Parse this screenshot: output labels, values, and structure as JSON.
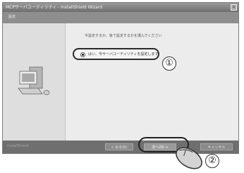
{
  "window": {
    "title": "MCPサーバユーティリティ - InstallShield Wizard",
    "subheader": "設定"
  },
  "main": {
    "instruction": "今設定するか、後で設定するかを選んでください",
    "option_label": "はい、今サーバユーティリティを設定します"
  },
  "footer": {
    "brand": "InstallShield",
    "back_label": "< 戻る(B)",
    "next_label": "次へ(N) >",
    "cancel_label": "キャンセル"
  },
  "callouts": {
    "first": "①",
    "second": "②"
  }
}
